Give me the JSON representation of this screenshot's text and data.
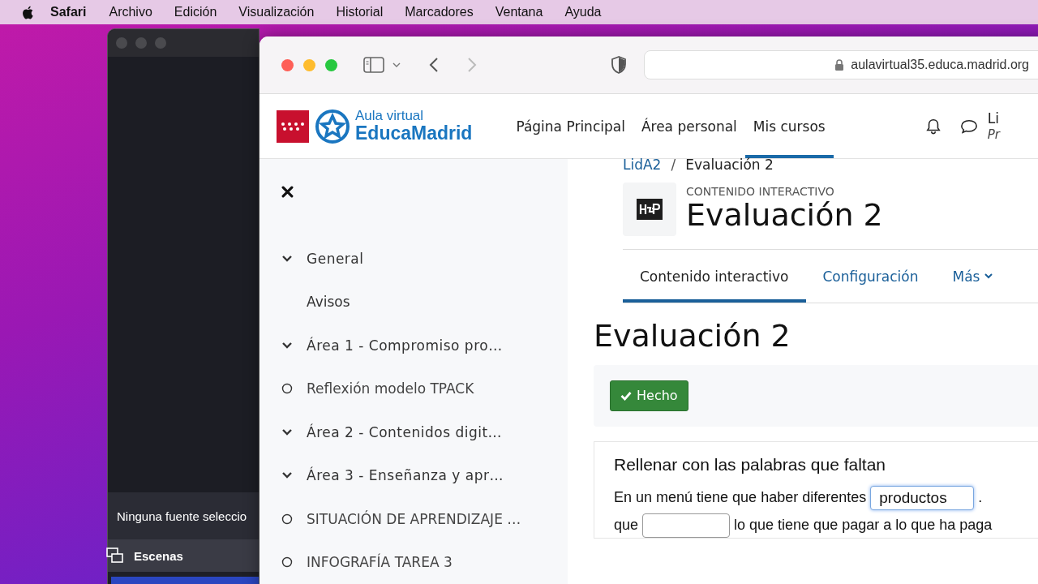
{
  "menu_bar": {
    "app": "Safari",
    "items": [
      "Archivo",
      "Edición",
      "Visualización",
      "Historial",
      "Marcadores",
      "Ventana",
      "Ayuda"
    ]
  },
  "obs_window": {
    "status": "Ninguna fuente seleccio",
    "panel": "Escenas"
  },
  "browser": {
    "url": "aulavirtual35.educa.madrid.org"
  },
  "site_header": {
    "logo_top": "Aula virtual",
    "logo_bottom": "EducaMadrid",
    "nav": [
      {
        "label": "Página Principal",
        "selected": false
      },
      {
        "label": "Área personal",
        "selected": false
      },
      {
        "label": "Mis cursos",
        "selected": true
      }
    ],
    "user_name": "Li",
    "user_role": "Pr"
  },
  "sidebar": {
    "items": [
      {
        "kind": "section",
        "label": "General",
        "expanded": true
      },
      {
        "kind": "link",
        "label": "Avisos"
      },
      {
        "kind": "section",
        "label": "Área 1 - Compromiso pro…",
        "expanded": true
      },
      {
        "kind": "activity",
        "label": "Reflexión modelo TPACK",
        "completed": false
      },
      {
        "kind": "section",
        "label": "Área 2 - Contenidos digit…",
        "expanded": true
      },
      {
        "kind": "section",
        "label": "Área 3 - Enseñanza y apr…",
        "expanded": true
      },
      {
        "kind": "activity",
        "label": "SITUACIÓN DE APRENDIZAJE …",
        "completed": false
      },
      {
        "kind": "activity",
        "label": "INFOGRAFÍA TAREA 3",
        "completed": false
      }
    ]
  },
  "breadcrumb": {
    "separator": "/",
    "items": [
      "LidA2",
      "Evaluación 2"
    ]
  },
  "activity_header": {
    "type_label": "CONTENIDO INTERACTIVO",
    "title": "Evaluación 2"
  },
  "tabs": [
    {
      "label": "Contenido interactivo",
      "selected": true,
      "dropdown": false
    },
    {
      "label": "Configuración",
      "selected": false,
      "dropdown": false
    },
    {
      "label": "Más",
      "selected": false,
      "dropdown": true
    }
  ],
  "page_title": "Evaluación 2",
  "completion_button": "Hecho",
  "exercise": {
    "title": "Rellenar con las palabras que faltan",
    "lines": [
      {
        "before": "En un menú tiene que haber diferentes",
        "value": "productos",
        "focused": true,
        "after": "."
      },
      {
        "before": "que",
        "focused": false,
        "after": "lo que tiene que pagar a lo que ha paga"
      }
    ]
  }
}
